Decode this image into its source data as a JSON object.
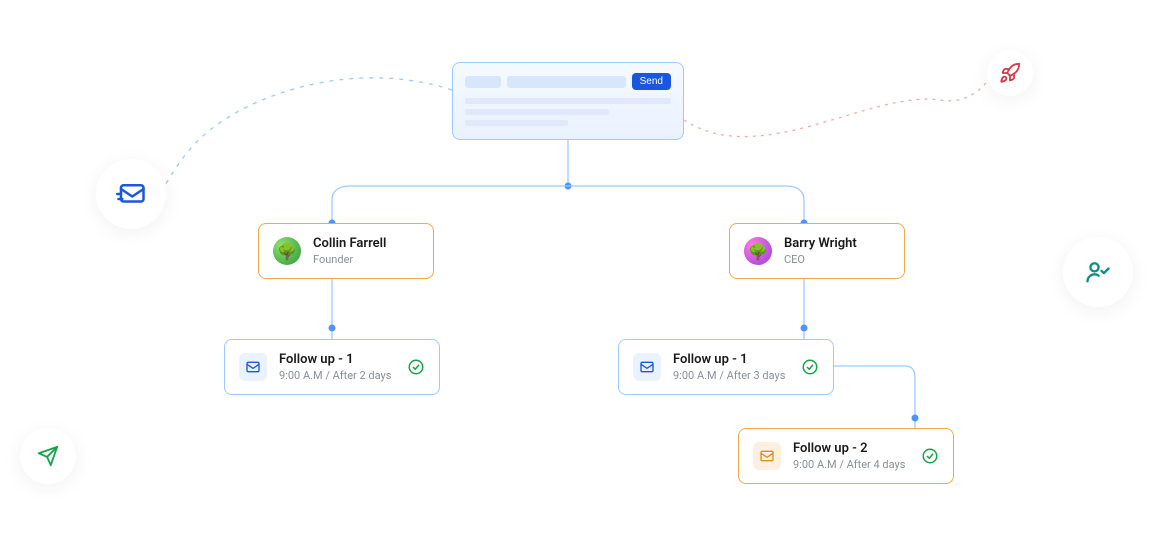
{
  "compose": {
    "send_label": "Send"
  },
  "people": {
    "left": {
      "name": "Collin Farrell",
      "role": "Founder"
    },
    "right": {
      "name": "Barry Wright",
      "role": "CEO"
    }
  },
  "followups": {
    "left1": {
      "title": "Follow up - 1",
      "meta": "9:00 A.M / After 2 days"
    },
    "right1": {
      "title": "Follow up - 1",
      "meta": "9:00 A.M / After 3 days"
    },
    "right2": {
      "title": "Follow up - 2",
      "meta": "9:00 A.M / After 4 days"
    }
  },
  "colors": {
    "blue": "#1957db",
    "orange": "#f0a94a",
    "green": "#16a34a",
    "teal": "#0f8f7f",
    "red": "#d23b4a"
  }
}
